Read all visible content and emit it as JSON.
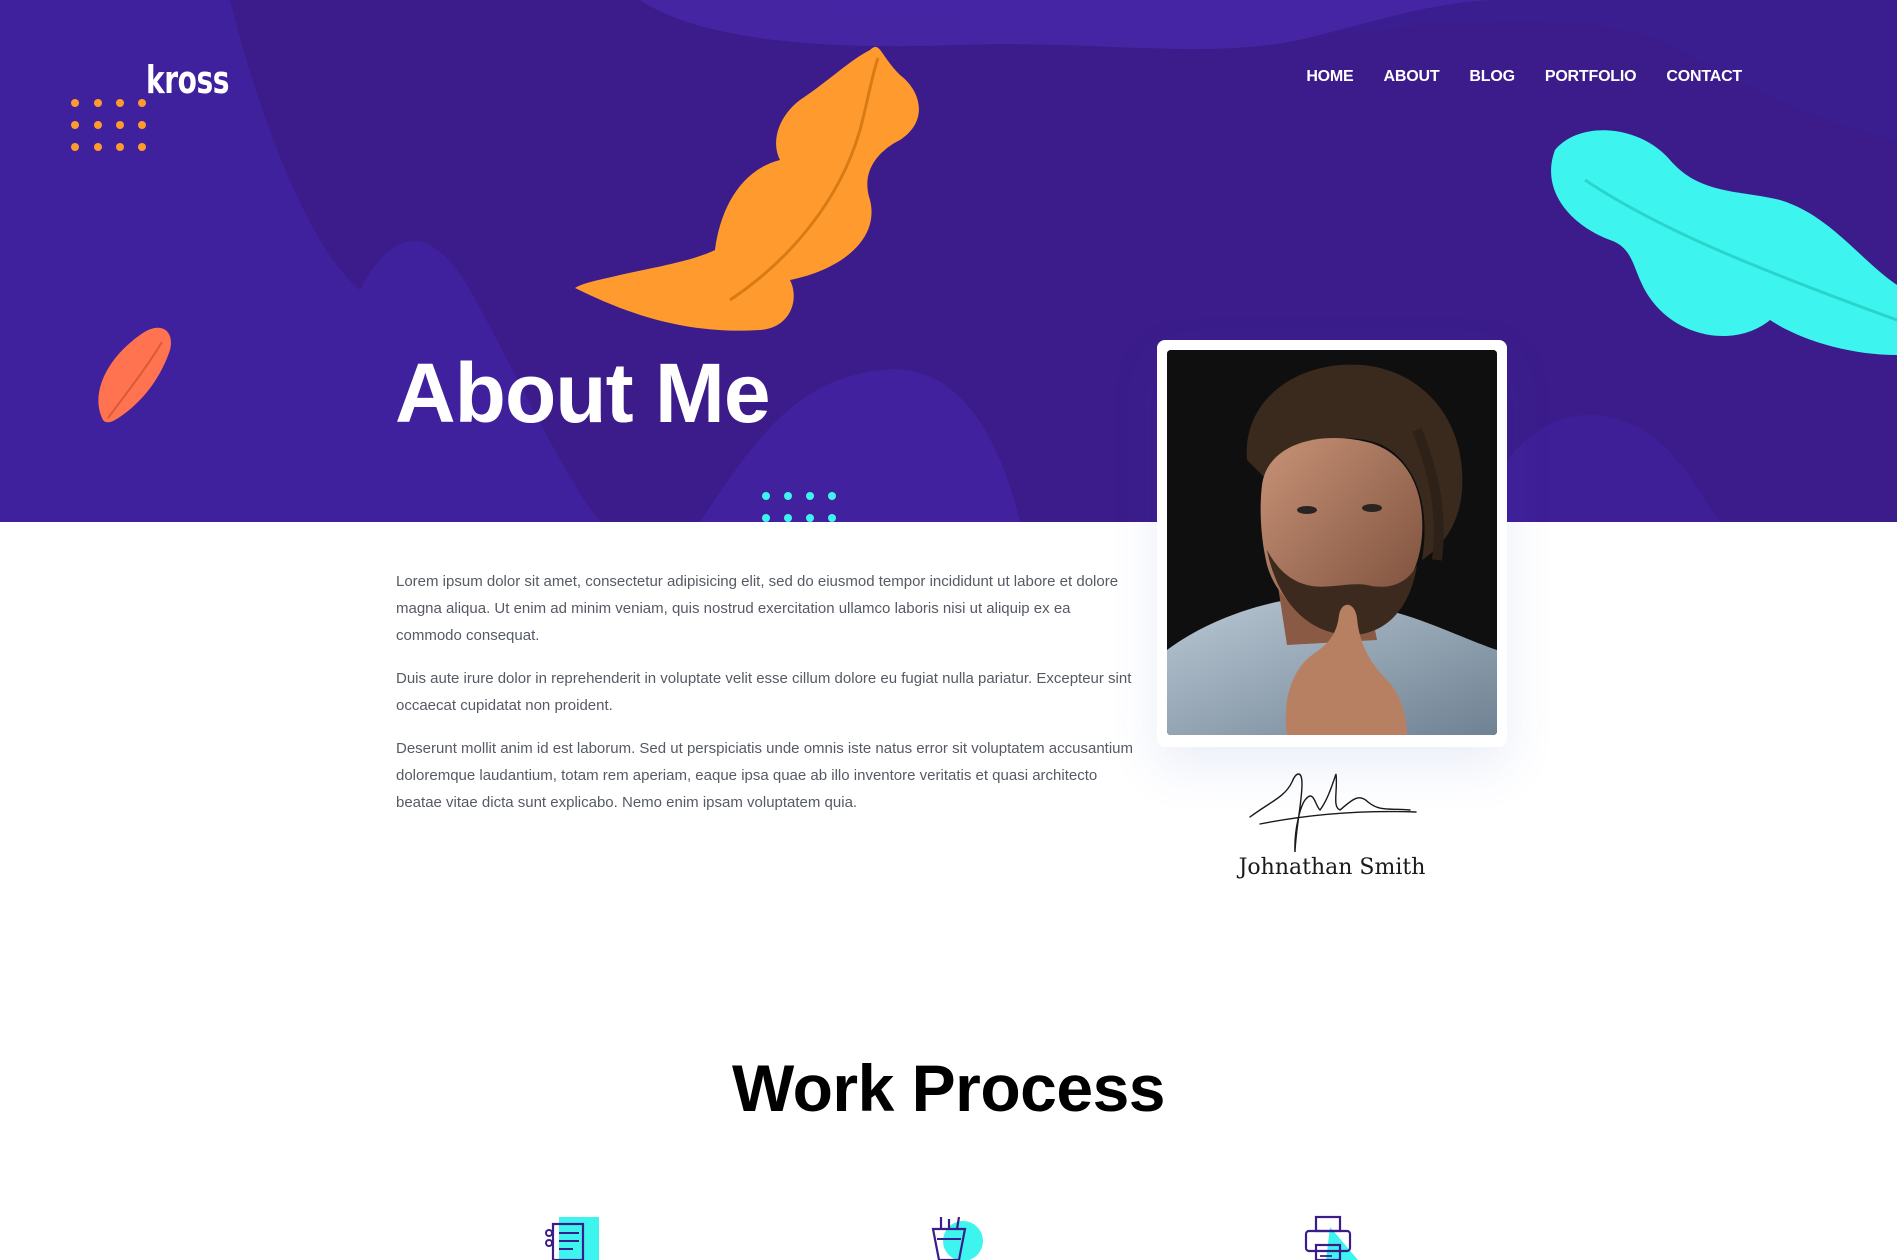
{
  "brand": {
    "logo_text": "kross"
  },
  "nav": {
    "items": [
      {
        "label": "HOME"
      },
      {
        "label": "ABOUT"
      },
      {
        "label": "BLOG"
      },
      {
        "label": "PORTFOLIO"
      },
      {
        "label": "CONTACT"
      }
    ]
  },
  "hero": {
    "title": "About Me"
  },
  "about": {
    "paragraphs": [
      "Lorem ipsum dolor sit amet, consectetur adipisicing elit, sed do eiusmod tempor incididunt ut labore et dolore magna aliqua. Ut enim ad minim veniam, quis nostrud exercitation ullamco laboris nisi ut aliquip ex ea commodo consequat.",
      "Duis aute irure dolor in reprehenderit in voluptate velit esse cillum dolore eu fugiat nulla pariatur. Excepteur sint occaecat cupidatat non proident.",
      "Deserunt mollit anim id est laborum. Sed ut perspiciatis unde omnis iste natus error sit voluptatem accusantium doloremque laudantium, totam rem aperiam, eaque ipsa quae ab illo inventore veritatis et quasi architecto beatae vitae dicta sunt explicabo. Nemo enim ipsam voluptatem quia."
    ],
    "signature_name": "Johnathan Smith"
  },
  "work_process": {
    "title": "Work Process",
    "icons": [
      "checklist-icon",
      "pencil-cup-icon",
      "printer-icon"
    ]
  },
  "colors": {
    "hero_bg": "#3b1c8a",
    "accent_orange": "#ff9b2e",
    "accent_cyan": "#3df5ee",
    "accent_coral": "#ff7350"
  }
}
